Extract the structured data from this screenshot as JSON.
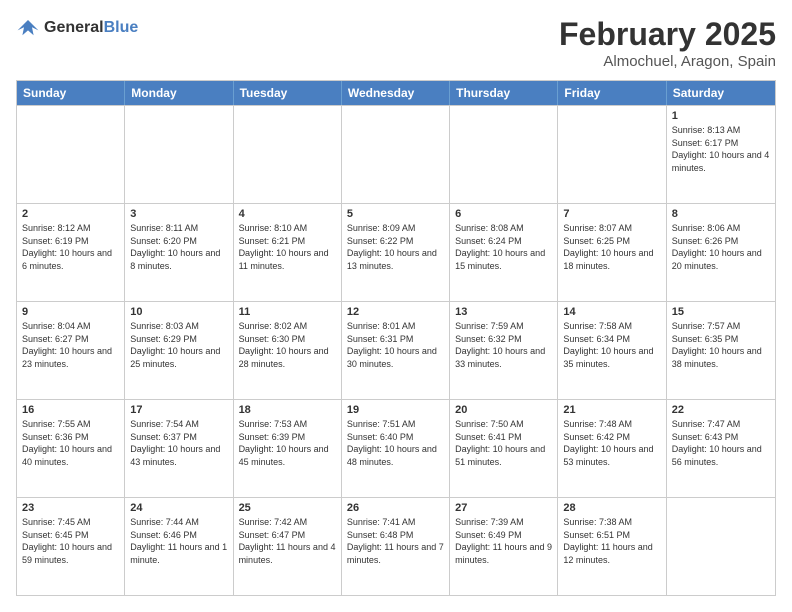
{
  "logo": {
    "text1": "General",
    "text2": "Blue"
  },
  "title": "February 2025",
  "subtitle": "Almochuel, Aragon, Spain",
  "header_days": [
    "Sunday",
    "Monday",
    "Tuesday",
    "Wednesday",
    "Thursday",
    "Friday",
    "Saturday"
  ],
  "weeks": [
    [
      {
        "day": "",
        "info": ""
      },
      {
        "day": "",
        "info": ""
      },
      {
        "day": "",
        "info": ""
      },
      {
        "day": "",
        "info": ""
      },
      {
        "day": "",
        "info": ""
      },
      {
        "day": "",
        "info": ""
      },
      {
        "day": "1",
        "info": "Sunrise: 8:13 AM\nSunset: 6:17 PM\nDaylight: 10 hours and 4 minutes."
      }
    ],
    [
      {
        "day": "2",
        "info": "Sunrise: 8:12 AM\nSunset: 6:19 PM\nDaylight: 10 hours and 6 minutes."
      },
      {
        "day": "3",
        "info": "Sunrise: 8:11 AM\nSunset: 6:20 PM\nDaylight: 10 hours and 8 minutes."
      },
      {
        "day": "4",
        "info": "Sunrise: 8:10 AM\nSunset: 6:21 PM\nDaylight: 10 hours and 11 minutes."
      },
      {
        "day": "5",
        "info": "Sunrise: 8:09 AM\nSunset: 6:22 PM\nDaylight: 10 hours and 13 minutes."
      },
      {
        "day": "6",
        "info": "Sunrise: 8:08 AM\nSunset: 6:24 PM\nDaylight: 10 hours and 15 minutes."
      },
      {
        "day": "7",
        "info": "Sunrise: 8:07 AM\nSunset: 6:25 PM\nDaylight: 10 hours and 18 minutes."
      },
      {
        "day": "8",
        "info": "Sunrise: 8:06 AM\nSunset: 6:26 PM\nDaylight: 10 hours and 20 minutes."
      }
    ],
    [
      {
        "day": "9",
        "info": "Sunrise: 8:04 AM\nSunset: 6:27 PM\nDaylight: 10 hours and 23 minutes."
      },
      {
        "day": "10",
        "info": "Sunrise: 8:03 AM\nSunset: 6:29 PM\nDaylight: 10 hours and 25 minutes."
      },
      {
        "day": "11",
        "info": "Sunrise: 8:02 AM\nSunset: 6:30 PM\nDaylight: 10 hours and 28 minutes."
      },
      {
        "day": "12",
        "info": "Sunrise: 8:01 AM\nSunset: 6:31 PM\nDaylight: 10 hours and 30 minutes."
      },
      {
        "day": "13",
        "info": "Sunrise: 7:59 AM\nSunset: 6:32 PM\nDaylight: 10 hours and 33 minutes."
      },
      {
        "day": "14",
        "info": "Sunrise: 7:58 AM\nSunset: 6:34 PM\nDaylight: 10 hours and 35 minutes."
      },
      {
        "day": "15",
        "info": "Sunrise: 7:57 AM\nSunset: 6:35 PM\nDaylight: 10 hours and 38 minutes."
      }
    ],
    [
      {
        "day": "16",
        "info": "Sunrise: 7:55 AM\nSunset: 6:36 PM\nDaylight: 10 hours and 40 minutes."
      },
      {
        "day": "17",
        "info": "Sunrise: 7:54 AM\nSunset: 6:37 PM\nDaylight: 10 hours and 43 minutes."
      },
      {
        "day": "18",
        "info": "Sunrise: 7:53 AM\nSunset: 6:39 PM\nDaylight: 10 hours and 45 minutes."
      },
      {
        "day": "19",
        "info": "Sunrise: 7:51 AM\nSunset: 6:40 PM\nDaylight: 10 hours and 48 minutes."
      },
      {
        "day": "20",
        "info": "Sunrise: 7:50 AM\nSunset: 6:41 PM\nDaylight: 10 hours and 51 minutes."
      },
      {
        "day": "21",
        "info": "Sunrise: 7:48 AM\nSunset: 6:42 PM\nDaylight: 10 hours and 53 minutes."
      },
      {
        "day": "22",
        "info": "Sunrise: 7:47 AM\nSunset: 6:43 PM\nDaylight: 10 hours and 56 minutes."
      }
    ],
    [
      {
        "day": "23",
        "info": "Sunrise: 7:45 AM\nSunset: 6:45 PM\nDaylight: 10 hours and 59 minutes."
      },
      {
        "day": "24",
        "info": "Sunrise: 7:44 AM\nSunset: 6:46 PM\nDaylight: 11 hours and 1 minute."
      },
      {
        "day": "25",
        "info": "Sunrise: 7:42 AM\nSunset: 6:47 PM\nDaylight: 11 hours and 4 minutes."
      },
      {
        "day": "26",
        "info": "Sunrise: 7:41 AM\nSunset: 6:48 PM\nDaylight: 11 hours and 7 minutes."
      },
      {
        "day": "27",
        "info": "Sunrise: 7:39 AM\nSunset: 6:49 PM\nDaylight: 11 hours and 9 minutes."
      },
      {
        "day": "28",
        "info": "Sunrise: 7:38 AM\nSunset: 6:51 PM\nDaylight: 11 hours and 12 minutes."
      },
      {
        "day": "",
        "info": ""
      }
    ]
  ]
}
